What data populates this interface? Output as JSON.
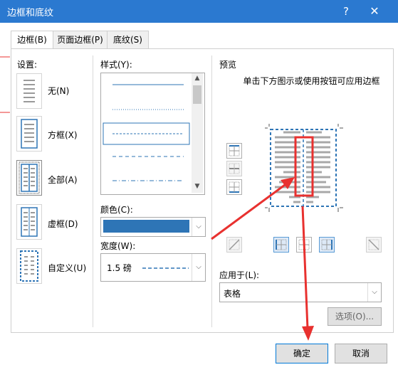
{
  "window": {
    "title": "边框和底纹",
    "help_label": "?",
    "close_label": "✕"
  },
  "tabs": [
    {
      "label": "边框(B)",
      "active": true
    },
    {
      "label": "页面边框(P)",
      "active": false
    },
    {
      "label": "底纹(S)",
      "active": false
    }
  ],
  "settings": {
    "label": "设置:",
    "items": [
      {
        "label": "无(N)",
        "icon": "none-icon"
      },
      {
        "label": "方框(X)",
        "icon": "box-icon"
      },
      {
        "label": "全部(A)",
        "icon": "all-icon",
        "selected": true
      },
      {
        "label": "虚框(D)",
        "icon": "grid-icon"
      },
      {
        "label": "自定义(U)",
        "icon": "custom-icon"
      }
    ]
  },
  "style": {
    "label": "样式(Y):",
    "selected_index": 3
  },
  "color": {
    "label": "颜色(C):",
    "value_color": "#2e75b6"
  },
  "width": {
    "label": "宽度(W):",
    "value": "1.5 磅"
  },
  "preview": {
    "label": "预览",
    "hint": "单击下方图示或使用按钮可应用边框"
  },
  "apply_to": {
    "label": "应用于(L):",
    "value": "表格"
  },
  "options_button": "选项(O)...",
  "ok_button": "确定",
  "cancel_button": "取消",
  "colors": {
    "titlebar": "#2b79d0",
    "border_line": "#2e75b6",
    "annotation": "#e8312f"
  }
}
